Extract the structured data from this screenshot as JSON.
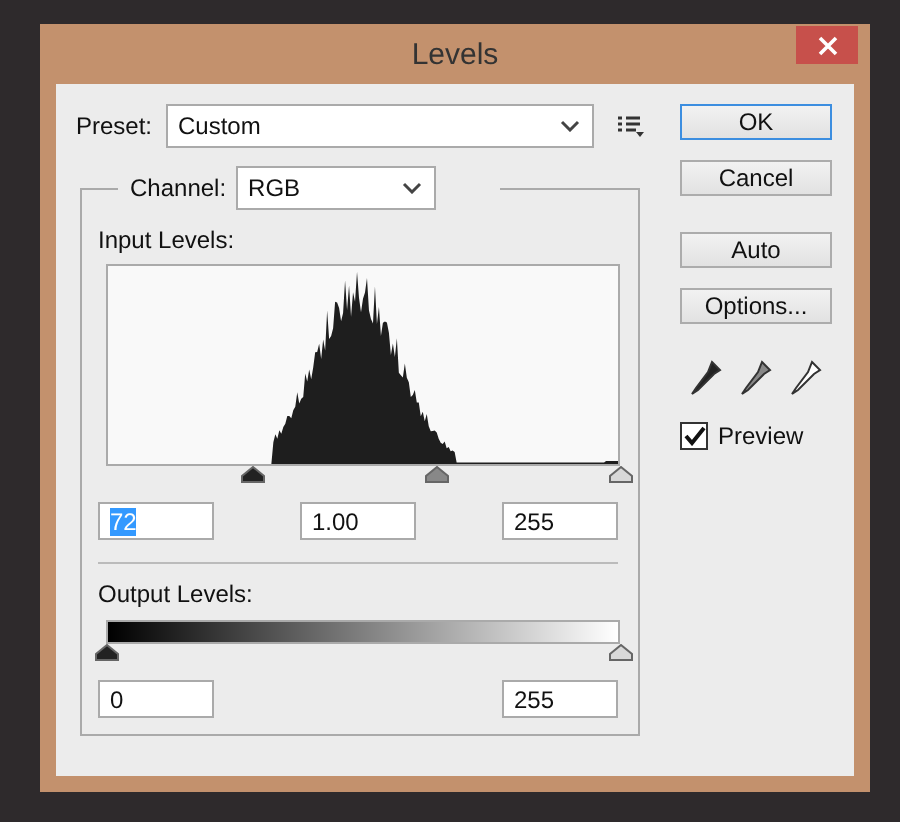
{
  "window": {
    "title": "Levels"
  },
  "preset": {
    "label": "Preset:",
    "value": "Custom"
  },
  "buttons": [
    {
      "label": "OK",
      "default": true
    },
    {
      "label": "Cancel",
      "default": false
    },
    {
      "label": "Auto",
      "default": false
    },
    {
      "label": "Options...",
      "default": false
    }
  ],
  "preview": {
    "label": "Preview",
    "checked": true
  },
  "channel": {
    "label": "Channel:",
    "value": "RGB"
  },
  "input_levels": {
    "label": "Input Levels:",
    "sliders": [
      {
        "kind": "shadow",
        "level": 0.284
      },
      {
        "kind": "midtone",
        "level": 0.642
      },
      {
        "kind": "highlight",
        "level": 1
      }
    ],
    "fields": [
      {
        "value": "72",
        "selected": true
      },
      {
        "value": "1.00",
        "selected": false
      },
      {
        "value": "255",
        "selected": false
      }
    ]
  },
  "output_levels": {
    "label": "Output Levels:",
    "sliders": [
      {
        "kind": "shadow",
        "level": 0
      },
      {
        "kind": "highlight",
        "level": 1
      }
    ],
    "fields": [
      {
        "value": "0",
        "selected": false
      },
      {
        "value": "255",
        "selected": false
      }
    ]
  }
}
